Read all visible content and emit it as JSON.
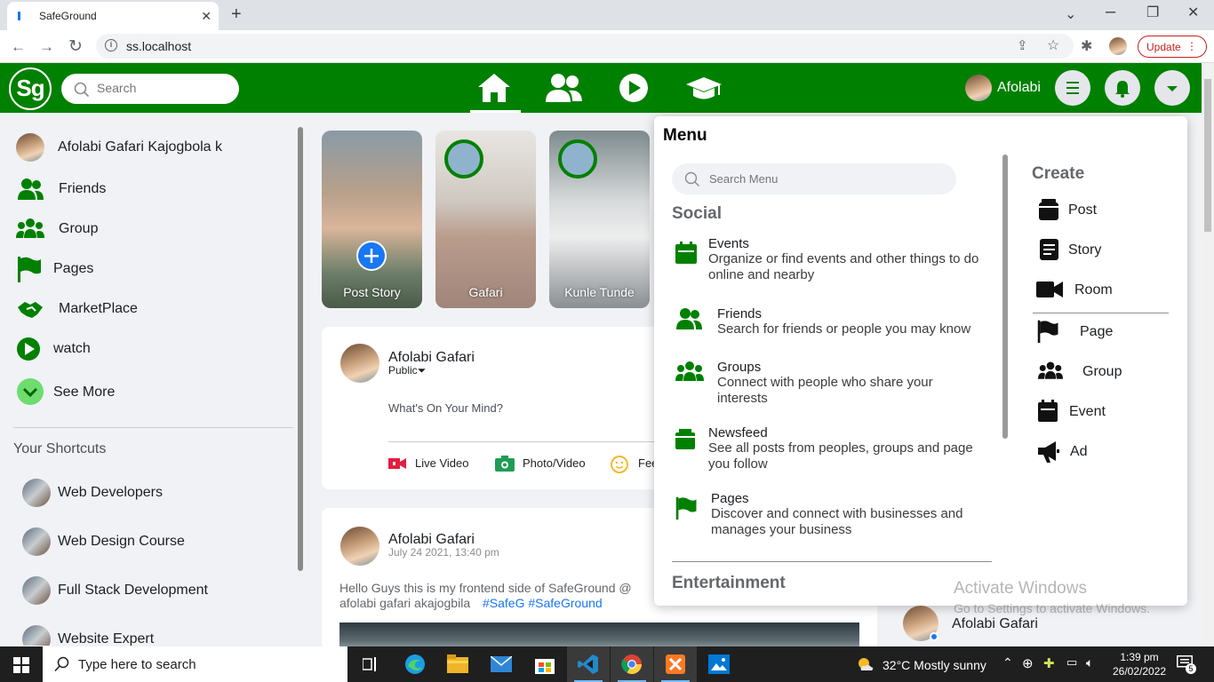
{
  "browser": {
    "tab_title": "SafeGround",
    "url": "ss.localhost",
    "update_label": "Update",
    "new_tab": "+",
    "tab_close": "✕"
  },
  "header": {
    "logo": "Sg",
    "search_placeholder": "Search",
    "user_name": "Afolabi",
    "brand_color": "#008000"
  },
  "sidebar": {
    "items": [
      {
        "label": "Afolabi Gafari Kajogbola k",
        "icon": "avatar"
      },
      {
        "label": "Friends",
        "icon": "friends-icon"
      },
      {
        "label": "Group",
        "icon": "group-icon"
      },
      {
        "label": "Pages",
        "icon": "flag-icon"
      },
      {
        "label": "MarketPlace",
        "icon": "handshake-icon"
      },
      {
        "label": "watch",
        "icon": "play-icon"
      },
      {
        "label": "See More",
        "icon": "chevron-down-icon"
      }
    ],
    "shortcuts_title": "Your Shortcuts",
    "shortcuts": [
      "Web Developers",
      "Web Design Course",
      "Full Stack Development",
      "Website Expert"
    ]
  },
  "stories": [
    {
      "name": "Post Story"
    },
    {
      "name": "Gafari"
    },
    {
      "name": "Kunle Tunde"
    }
  ],
  "composer": {
    "user": "Afolabi Gafari",
    "privacy": "Public",
    "placeholder": "What's On Your Mind?",
    "actions": [
      "Live Video",
      "Photo/Video",
      "Feeling/Activity"
    ]
  },
  "post": {
    "author": "Afolabi Gafari",
    "time": "July 24 2021, 13:40 pm",
    "text": "Hello Guys this is my frontend side of SafeGround @",
    "text2": "afolabi gafari akajogbila",
    "tags": "#SafeG #SafeGround"
  },
  "menu": {
    "title": "Menu",
    "search_placeholder": "Search Menu",
    "social_title": "Social",
    "items": [
      {
        "title": "Events",
        "desc": "Organize or find events and other things to do online and nearby"
      },
      {
        "title": "Friends",
        "desc": "Search for friends or people you may know"
      },
      {
        "title": "Groups",
        "desc": "Connect with people who share your interests"
      },
      {
        "title": "Newsfeed",
        "desc": "See all posts from peoples, groups and page you follow"
      },
      {
        "title": "Pages",
        "desc": "Discover and connect with businesses and manages your business"
      }
    ],
    "entertainment_title": "Entertainment",
    "create_title": "Create",
    "create": [
      "Post",
      "Story",
      "Room",
      "Page",
      "Group",
      "Event",
      "Ad"
    ]
  },
  "watermark": {
    "line1": "Activate Windows",
    "line2": "Go to Settings to activate Windows."
  },
  "contact": {
    "name": "Afolabi Gafari"
  },
  "taskbar": {
    "search": "Type here to search",
    "weather": "32°C  Mostly sunny",
    "time": "1:39 pm",
    "date": "26/02/2022",
    "notifications": "5"
  }
}
